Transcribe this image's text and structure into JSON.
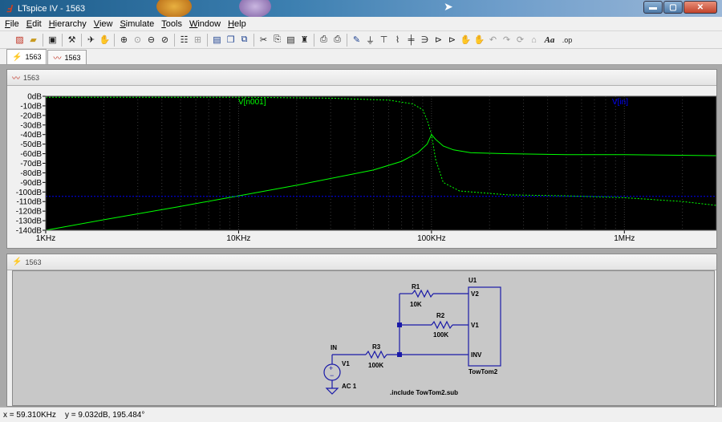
{
  "window": {
    "title": "LTspice IV - 1563",
    "buttons": {
      "minimize": "▬",
      "maximize": "▢",
      "close": "✕"
    }
  },
  "menu": {
    "items": [
      "File",
      "Edit",
      "Hierarchy",
      "View",
      "Simulate",
      "Tools",
      "Window",
      "Help"
    ]
  },
  "toolbar": {
    "icons": [
      "new-schematic-icon",
      "open-icon",
      "save-icon",
      "control-panel-icon",
      "run-icon",
      "halt-icon",
      "zoom-in-icon",
      "pan-icon",
      "zoom-out-icon",
      "zoom-fit-icon",
      "autorange-icon",
      "tile-horizontal-icon",
      "cascade-icon",
      "close-window-icon",
      "cut-icon",
      "copy-icon",
      "paste-icon",
      "find-icon",
      "print-setup-icon",
      "print-icon",
      "draw-wire-icon",
      "ground-icon",
      "label-net-icon",
      "resistor-icon",
      "capacitor-icon",
      "inductor-icon",
      "diode-icon",
      "component-icon",
      "move-icon",
      "drag-icon",
      "undo-icon",
      "redo-icon",
      "rotate-icon",
      "mirror-icon",
      "text-icon",
      "spice-directive-icon"
    ],
    "text_label": "Aa",
    "op_label": ".op"
  },
  "tabs": [
    {
      "label": "1563",
      "icon": "schematic-icon"
    },
    {
      "label": "1563",
      "icon": "waveform-icon"
    }
  ],
  "plot_pane": {
    "title": "1563",
    "trace_labels": {
      "magnitude": "V[n001]",
      "phase": "V[in]"
    },
    "colors": {
      "bg": "#000000",
      "trace1": "#00ff00",
      "trace2": "#0000ff",
      "grid": "#3a3a3a"
    }
  },
  "chart_data": {
    "type": "line",
    "xscale": "log",
    "xlim": [
      1000,
      3000000
    ],
    "ylim": [
      -140,
      0
    ],
    "x_ticks": [
      "1KHz",
      "10KHz",
      "100KHz",
      "1MHz"
    ],
    "y_ticks": [
      "0dB",
      "-10dB",
      "-20dB",
      "-30dB",
      "-40dB",
      "-50dB",
      "-60dB",
      "-70dB",
      "-80dB",
      "-90dB",
      "-100dB",
      "-110dB",
      "-120dB",
      "-130dB",
      "-140dB"
    ],
    "series": [
      {
        "name": "V[n001]",
        "style": "solid",
        "x": [
          1000,
          2000,
          5000,
          10000,
          20000,
          50000,
          70000,
          85000,
          95000,
          100000,
          105000,
          115000,
          130000,
          160000,
          250000,
          500000,
          1000000,
          3000000
        ],
        "y": [
          -140,
          -129,
          -115,
          -104,
          -93,
          -77,
          -68,
          -59,
          -50,
          -40,
          -45,
          -52,
          -56,
          -59,
          -60,
          -61,
          -61,
          -62
        ]
      },
      {
        "name": "V[n001] phase",
        "style": "dashed",
        "x": [
          1000,
          10000,
          30000,
          60000,
          80000,
          90000,
          95000,
          100000,
          105000,
          115000,
          140000,
          250000,
          500000,
          1000000,
          2000000,
          3000000
        ],
        "y": [
          -1,
          -1,
          -2,
          -4,
          -8,
          -14,
          -25,
          -40,
          -66,
          -90,
          -99,
          -103,
          -104,
          -106,
          -110,
          -114
        ]
      },
      {
        "name": "V[in]",
        "style": "solid",
        "x": [
          1000,
          3000000
        ],
        "y": [
          0,
          0
        ]
      },
      {
        "name": "V[in] phase",
        "style": "dashed",
        "x": [
          1000,
          3000000
        ],
        "y": [
          -104.5,
          -104.5
        ]
      }
    ]
  },
  "schematic_pane": {
    "title": "1563",
    "labels": {
      "u1": "U1",
      "r1": "R1",
      "r1_val": "10K",
      "r2": "R2",
      "r2_val": "100K",
      "r3": "R3",
      "r3_val": "100K",
      "v1": "V1",
      "v1_val": "AC 1",
      "in_net": "IN",
      "pin_v2": "V2",
      "pin_v1": "V1",
      "pin_inv": "INV",
      "u1_model": "TowTom2",
      "directive": ".include TowTom2.sub"
    }
  },
  "status": {
    "text": "x = 59.310KHz    y = 9.032dB, 195.484°"
  }
}
